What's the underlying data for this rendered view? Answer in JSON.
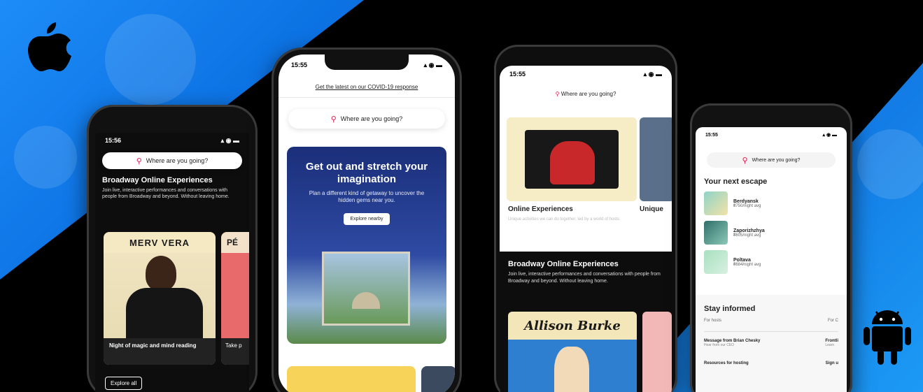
{
  "phone1": {
    "time": "15:56",
    "search_placeholder": "Where are you going?",
    "title": "Broadway Online Experiences",
    "description": "Join live, interactive performances and conversations with people from Broadway and beyond. Without leaving home.",
    "card1_poster_title": "MERV VERA",
    "card1_caption": "Night of magic and mind reading",
    "card2_poster_title": "PÉ",
    "card2_caption": "Take p",
    "explore_all": "Explore all"
  },
  "phone2": {
    "time": "15:55",
    "covid_link": "Get the latest on our COVID-19 response",
    "search_placeholder": "Where are you going?",
    "hero_title": "Get out and stretch your imagination",
    "hero_subtitle": "Plan a different kind of getaway to uncover the hidden gems near you.",
    "explore_button": "Explore nearby"
  },
  "phone3": {
    "time": "15:55",
    "search_placeholder": "Where are you going?",
    "card1_title": "Online Experiences",
    "card1_desc": "Unique activities we can do together, led by a world of hosts",
    "card2_title": "Unique",
    "broadway_title": "Broadway Online Experiences",
    "broadway_desc": "Join live, interactive performances and conversations with people from Broadway and beyond. Without leaving home.",
    "poster_name": "Allison Burke"
  },
  "phone4": {
    "time": "15:55",
    "search_placeholder": "Where are you going?",
    "next_escape_title": "Your next escape",
    "escapes": [
      {
        "name": "Berdyansk",
        "price": "₴750/night avg"
      },
      {
        "name": "Zaporizhzhya",
        "price": "₴605/night avg"
      },
      {
        "name": "Poltava",
        "price": "₴684/night avg"
      }
    ],
    "stay_informed_title": "Stay informed",
    "for_hosts": "For hosts",
    "for_co": "For C",
    "msg_title": "Message from Brian Chesky",
    "msg_sub": "Hear from our CEO",
    "frontline": "Frontli",
    "frontline_sub": "Learn",
    "resources": "Resources for hosting",
    "sign_up": "Sign u"
  },
  "colors": {
    "brand": "#e0174a",
    "blue": "#0a6fe0",
    "dark_screen": "#0d0d0d",
    "hero_navy": "#1f3a8a"
  }
}
